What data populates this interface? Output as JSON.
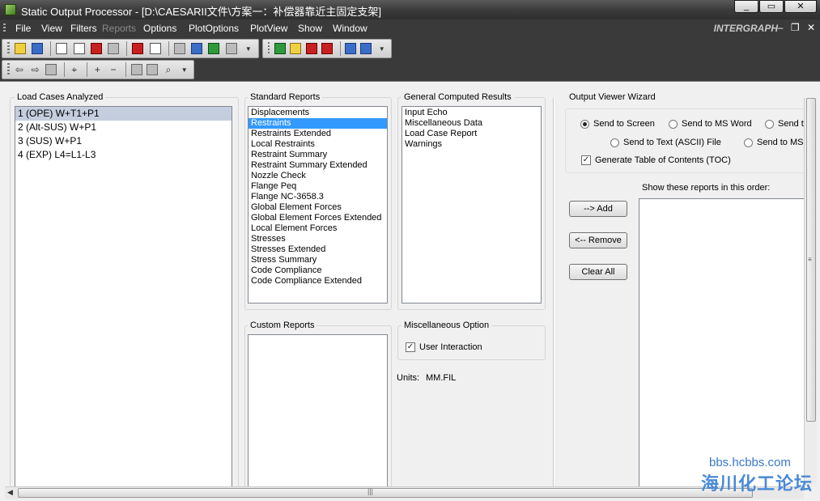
{
  "window": {
    "title": "Static Output Processor - [D:\\CAESARII文件\\方案一：补偿器靠近主固定支架]",
    "controls": [
      "_",
      "▭",
      "✕"
    ]
  },
  "menubar": {
    "items": [
      "File",
      "View",
      "Filters",
      "Reports",
      "Options",
      "PlotOptions",
      "PlotView",
      "Show",
      "Window"
    ],
    "brand": "INTERGRAPH",
    "mdi_controls": [
      "–",
      "❐",
      "✕"
    ]
  },
  "load_cases": {
    "label": "Load Cases Analyzed",
    "items": [
      "1 (OPE) W+T1+P1",
      "2 (Alt-SUS) W+P1",
      "3 (SUS) W+P1",
      "4 (EXP) L4=L1-L3"
    ],
    "selected_index": 0
  },
  "standard_reports": {
    "label": "Standard Reports",
    "items": [
      "Displacements",
      "Restraints",
      "Restraints Extended",
      "Local Restraints",
      "Restraint Summary",
      "Restraint Summary Extended",
      "Nozzle Check",
      "Flange Peq",
      "Flange NC-3658.3",
      "Global Element Forces",
      "Global Element Forces Extended",
      "Local Element Forces",
      "Stresses",
      "Stresses Extended",
      "Stress Summary",
      "Code Compliance",
      "Code Compliance Extended"
    ],
    "selected_index": 1
  },
  "general_results": {
    "label": "General Computed Results",
    "items": [
      "Input Echo",
      "Miscellaneous Data",
      "Load Case Report",
      "Warnings"
    ]
  },
  "custom_reports": {
    "label": "Custom Reports"
  },
  "misc_option": {
    "label": "Miscellaneous Option",
    "user_interaction": "User Interaction",
    "user_interaction_checked": true
  },
  "units": {
    "label": "Units:",
    "value": "MM.FIL"
  },
  "wizard": {
    "label": "Output Viewer Wizard",
    "radio_screen": "Send to Screen",
    "radio_word": "Send to MS Word",
    "radio_third": "Send t",
    "radio_text": "Send to Text (ASCII) File",
    "radio_ms": "Send to MS",
    "toc": "Generate Table of Contents (TOC)",
    "toc_checked": true,
    "order_label": "Show these reports in this order:",
    "add": "--> Add",
    "remove": "<-- Remove",
    "clear_all": "Clear All"
  },
  "watermark": {
    "line1": "bbs.hcbbs.com",
    "line2": "海川化工论坛"
  }
}
